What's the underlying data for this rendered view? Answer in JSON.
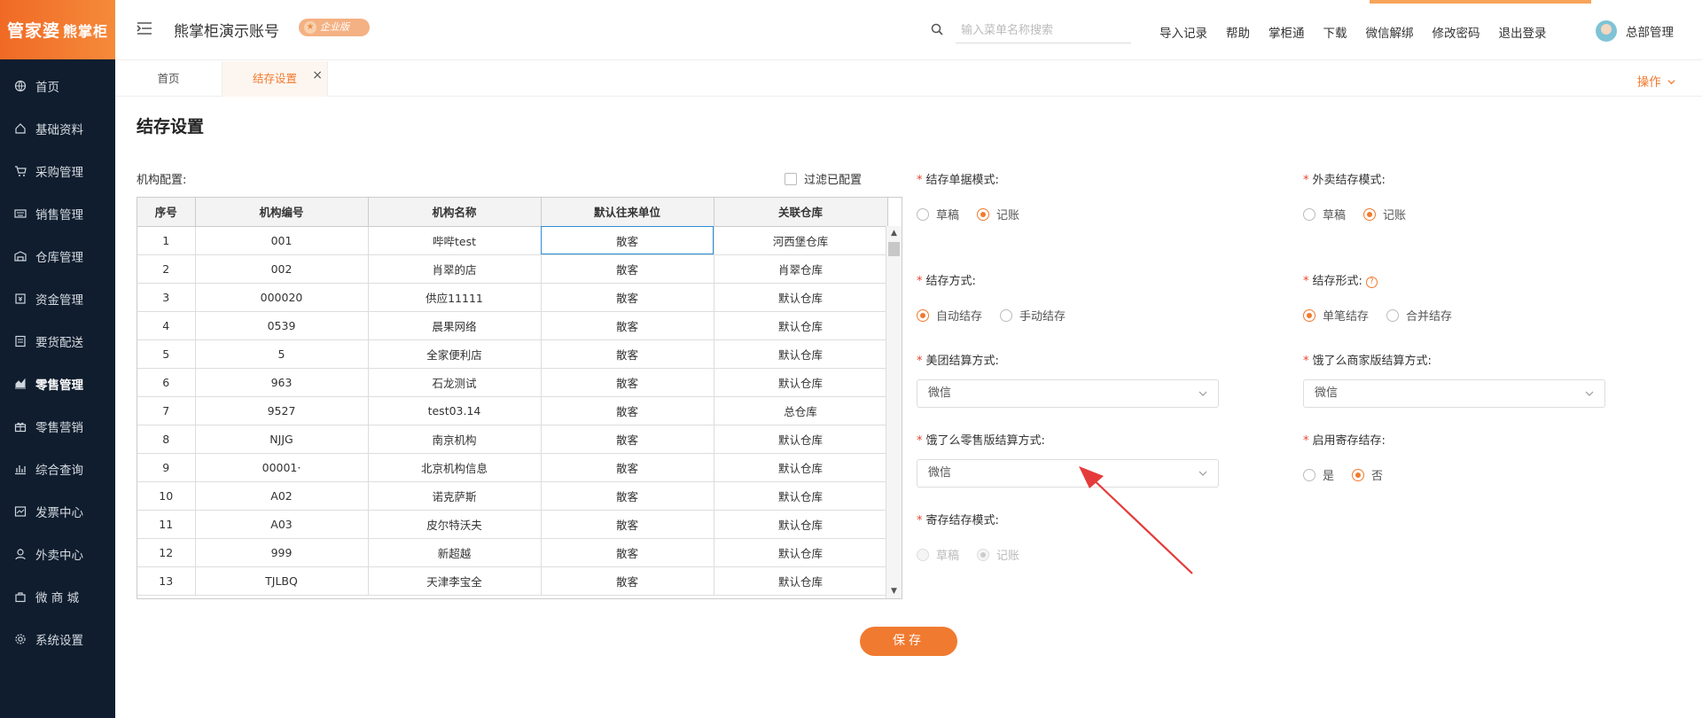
{
  "app": {
    "logo_text": "管家婆",
    "logo_sub": "熊掌柜",
    "account_name": "熊掌柜演示账号",
    "badge": "企业版"
  },
  "sidebar": {
    "items": [
      {
        "label": "首页",
        "icon": "globe-icon"
      },
      {
        "label": "基础资料",
        "icon": "home-icon"
      },
      {
        "label": "采购管理",
        "icon": "cart-icon"
      },
      {
        "label": "销售管理",
        "icon": "keyboard-icon"
      },
      {
        "label": "仓库管理",
        "icon": "warehouse-icon"
      },
      {
        "label": "资金管理",
        "icon": "money-icon"
      },
      {
        "label": "要货配送",
        "icon": "document-icon"
      },
      {
        "label": "零售管理",
        "icon": "chart-icon",
        "active": true
      },
      {
        "label": "零售营销",
        "icon": "gift-icon"
      },
      {
        "label": "综合查询",
        "icon": "bar-chart-icon"
      },
      {
        "label": "发票中心",
        "icon": "invoice-icon"
      },
      {
        "label": "外卖中心",
        "icon": "delivery-icon"
      },
      {
        "label": "微 商 城",
        "icon": "shop-icon"
      },
      {
        "label": "系统设置",
        "icon": "gear-icon"
      }
    ]
  },
  "header": {
    "search_placeholder": "输入菜单名称搜索",
    "links": [
      "导入记录",
      "帮助",
      "掌柜通",
      "下载",
      "微信解绑",
      "修改密码",
      "退出登录"
    ],
    "user": "总部管理"
  },
  "tabs": {
    "home": "首页",
    "active": "结存设置",
    "close": "×",
    "ops": "操作"
  },
  "page": {
    "title": "结存设置",
    "org_label": "机构配置:",
    "filter_label": "过滤已配置"
  },
  "table": {
    "columns": [
      "序号",
      "机构编号",
      "机构名称",
      "默认往来单位",
      "关联仓库"
    ],
    "rows": [
      [
        "1",
        "001",
        "哔哔test",
        "散客",
        "河西堡仓库"
      ],
      [
        "2",
        "002",
        "肖翠的店",
        "散客",
        "肖翠仓库"
      ],
      [
        "3",
        "000020",
        "供应11111",
        "散客",
        "默认仓库"
      ],
      [
        "4",
        "0539",
        "晨果网络",
        "散客",
        "默认仓库"
      ],
      [
        "5",
        "5",
        "全家便利店",
        "散客",
        "默认仓库"
      ],
      [
        "6",
        "963",
        "石龙测试",
        "散客",
        "默认仓库"
      ],
      [
        "7",
        "9527",
        "test03.14",
        "散客",
        "总仓库"
      ],
      [
        "8",
        "NJJG",
        "南京机构",
        "散客",
        "默认仓库"
      ],
      [
        "9",
        "00001·",
        "北京机构信息",
        "散客",
        "默认仓库"
      ],
      [
        "10",
        "A02",
        "诺克萨斯",
        "散客",
        "默认仓库"
      ],
      [
        "11",
        "A03",
        "皮尔特沃夫",
        "散客",
        "默认仓库"
      ],
      [
        "12",
        "999",
        "新超越",
        "散客",
        "默认仓库"
      ],
      [
        "13",
        "TJLBQ",
        "天津李宝全",
        "散客",
        "默认仓库"
      ]
    ]
  },
  "form": {
    "doc_mode": {
      "label": "结存单据模式:",
      "options": [
        "草稿",
        "记账"
      ],
      "selected": "记账"
    },
    "takeout_mode": {
      "label": "外卖结存模式:",
      "options": [
        "草稿",
        "记账"
      ],
      "selected": "记账"
    },
    "method": {
      "label": "结存方式:",
      "options": [
        "自动结存",
        "手动结存"
      ],
      "selected": "自动结存"
    },
    "form_type": {
      "label": "结存形式:",
      "help": "?",
      "options": [
        "单笔结存",
        "合并结存"
      ],
      "selected": "单笔结存"
    },
    "meituan": {
      "label": "美团结算方式:",
      "value": "微信"
    },
    "eleme_merchant": {
      "label": "饿了么商家版结算方式:",
      "value": "微信"
    },
    "eleme_retail": {
      "label": "饿了么零售版结算方式:",
      "value": "微信"
    },
    "consign_enable": {
      "label": "启用寄存结存:",
      "options": [
        "是",
        "否"
      ],
      "selected": "否"
    },
    "consign_mode": {
      "label": "寄存结存模式:",
      "options": [
        "草稿",
        "记账"
      ],
      "selected": "记账",
      "disabled": true
    },
    "required_mark": "*"
  },
  "save_label": "保存",
  "colors": {
    "accent": "#f07a2f",
    "sidebar_bg": "#0f1d2e",
    "required": "#e8442c",
    "arrow": "#e53a3a"
  }
}
